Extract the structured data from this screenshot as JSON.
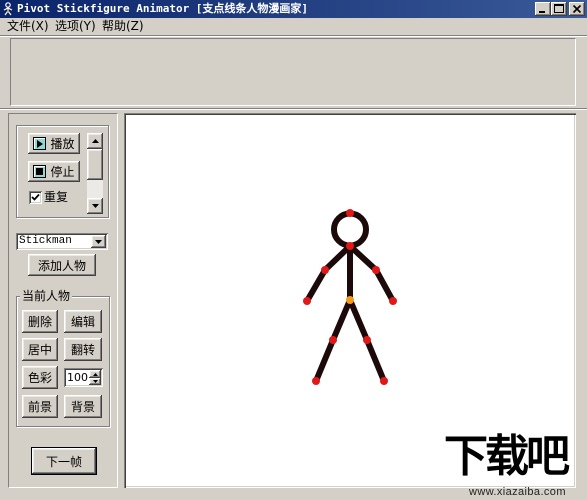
{
  "window": {
    "title": "Pivot Stickfigure Animator [支点线条人物漫画家]",
    "app_icon": "stickfigure-icon",
    "controls": [
      "minimize-icon",
      "maximize-icon",
      "close-icon"
    ]
  },
  "menu": {
    "items": [
      {
        "label": "文件(X)"
      },
      {
        "label": "选项(Y)"
      },
      {
        "label": "帮助(Z)"
      }
    ]
  },
  "playback": {
    "play_label": "播放",
    "play_icon": "play-icon",
    "stop_label": "停止",
    "stop_icon": "stop-icon",
    "repeat_label": "重复",
    "repeat_checked": true,
    "speed_slider_fraction": 0
  },
  "figure_type": {
    "selected": "Stickman"
  },
  "add_figure_label": "添加人物",
  "current_figure": {
    "group_label": "当前人物",
    "delete_label": "删除",
    "edit_label": "编辑",
    "center_label": "居中",
    "flip_label": "翻转",
    "color_label": "色彩",
    "size_value": "100",
    "front_label": "前景",
    "back_label": "背景"
  },
  "next_frame_label": "下一帧",
  "watermark": {
    "logo": "下载吧",
    "url": "www.xiazaiba.com"
  },
  "colors": {
    "title_bar": "#0a246a",
    "window_bg": "#d4d0c8",
    "canvas_bg": "#ffffff",
    "figure_line": "#1c0a0a",
    "joint": "#e01818",
    "root_joint": "#f29a1a"
  }
}
